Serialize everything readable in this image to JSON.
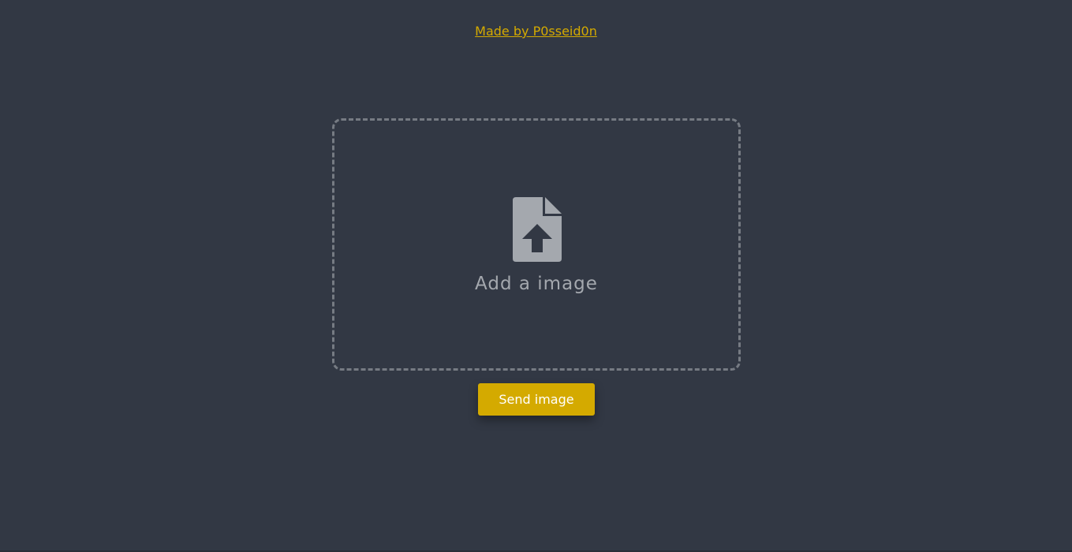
{
  "header": {
    "credit_link": "Made by P0sseid0n"
  },
  "upload": {
    "icon": "file-upload-icon",
    "label": "Add a image"
  },
  "actions": {
    "send_label": "Send image"
  },
  "colors": {
    "background": "#323844",
    "accent": "#d4aa00",
    "dropzone_border": "#767b83",
    "muted_text": "#a4a8ae",
    "icon": "#a4a8ae"
  }
}
